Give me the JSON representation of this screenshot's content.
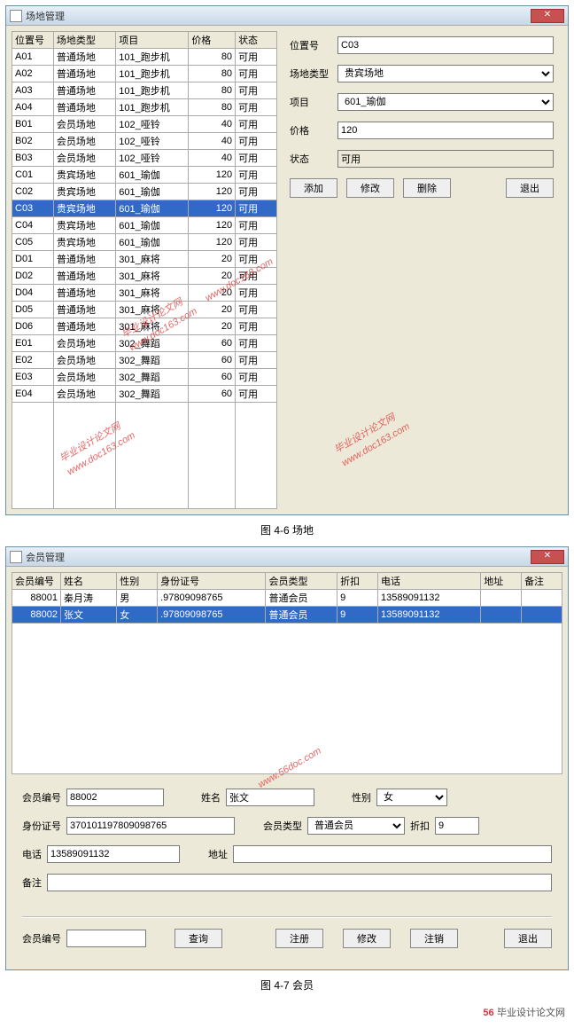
{
  "window1": {
    "title": "场地管理",
    "close": "✕",
    "headers": [
      "位置号",
      "场地类型",
      "项目",
      "价格",
      "状态"
    ],
    "rows": [
      [
        "A01",
        "普通场地",
        "101_跑步机",
        "80",
        "可用"
      ],
      [
        "A02",
        "普通场地",
        "101_跑步机",
        "80",
        "可用"
      ],
      [
        "A03",
        "普通场地",
        "101_跑步机",
        "80",
        "可用"
      ],
      [
        "A04",
        "普通场地",
        "101_跑步机",
        "80",
        "可用"
      ],
      [
        "B01",
        "会员场地",
        "102_哑铃",
        "40",
        "可用"
      ],
      [
        "B02",
        "会员场地",
        "102_哑铃",
        "40",
        "可用"
      ],
      [
        "B03",
        "会员场地",
        "102_哑铃",
        "40",
        "可用"
      ],
      [
        "C01",
        "贵宾场地",
        "601_瑜伽",
        "120",
        "可用"
      ],
      [
        "C02",
        "贵宾场地",
        "601_瑜伽",
        "120",
        "可用"
      ],
      [
        "C03",
        "贵宾场地",
        "601_瑜伽",
        "120",
        "可用"
      ],
      [
        "C04",
        "贵宾场地",
        "601_瑜伽",
        "120",
        "可用"
      ],
      [
        "C05",
        "贵宾场地",
        "601_瑜伽",
        "120",
        "可用"
      ],
      [
        "D01",
        "普通场地",
        "301_麻将",
        "20",
        "可用"
      ],
      [
        "D02",
        "普通场地",
        "301_麻将",
        "20",
        "可用"
      ],
      [
        "D04",
        "普通场地",
        "301_麻将",
        "20",
        "可用"
      ],
      [
        "D05",
        "普通场地",
        "301_麻将",
        "20",
        "可用"
      ],
      [
        "D06",
        "普通场地",
        "301_麻将",
        "20",
        "可用"
      ],
      [
        "E01",
        "会员场地",
        "302_舞蹈",
        "60",
        "可用"
      ],
      [
        "E02",
        "会员场地",
        "302_舞蹈",
        "60",
        "可用"
      ],
      [
        "E03",
        "会员场地",
        "302_舞蹈",
        "60",
        "可用"
      ],
      [
        "E04",
        "会员场地",
        "302_舞蹈",
        "60",
        "可用"
      ]
    ],
    "selected": 9,
    "form": {
      "l_pos": "位置号",
      "pos": "C03",
      "l_type": "场地类型",
      "type": "贵宾场地",
      "l_item": "项目",
      "item": "601_瑜伽",
      "l_price": "价格",
      "price": "120",
      "l_status": "状态",
      "status": "可用"
    },
    "buttons": {
      "add": "添加",
      "edit": "修改",
      "del": "删除",
      "exit": "退出"
    }
  },
  "caption1": "图 4-6  场地",
  "window2": {
    "title": "会员管理",
    "close": "✕",
    "headers": [
      "会员编号",
      "姓名",
      "性别",
      "身份证号",
      "会员类型",
      "折扣",
      "电话",
      "地址",
      "备注"
    ],
    "rows": [
      [
        "88001",
        "秦月涛",
        "男",
        ".97809098765",
        "普通会员",
        "9",
        "13589091132",
        "",
        ""
      ],
      [
        "88002",
        "张文",
        "女",
        ".97809098765",
        "普通会员",
        "9",
        "13589091132",
        "",
        ""
      ]
    ],
    "selected": 1,
    "form": {
      "l_id": "会员编号",
      "id": "88002",
      "l_name": "姓名",
      "name": "张文",
      "l_sex": "性别",
      "sex": "女",
      "l_card": "身份证号",
      "card": "370101197809098765",
      "l_type": "会员类型",
      "type": "普通会员",
      "l_disc": "折扣",
      "disc": "9",
      "l_phone": "电话",
      "phone": "13589091132",
      "l_addr": "地址",
      "addr": "",
      "l_note": "备注",
      "note": ""
    },
    "query": {
      "l_id": "会员编号",
      "btn": "查询"
    },
    "buttons": {
      "reg": "注册",
      "edit": "修改",
      "cancel": "注销",
      "exit": "退出"
    }
  },
  "caption2": "图 4-7 会员",
  "watermark": {
    "a": "毕业设计论文网",
    "b": "www.doc163.com",
    "c": "www.56doc.com"
  },
  "footer": {
    "icon": "56",
    "text": "毕业设计论文网"
  }
}
